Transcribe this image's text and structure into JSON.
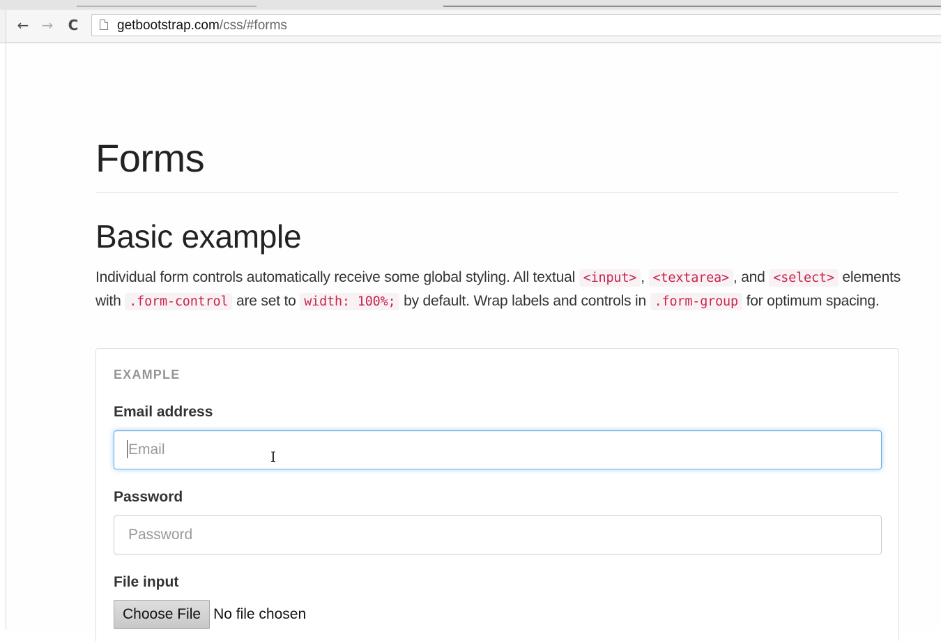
{
  "browser": {
    "back_glyph": "←",
    "forward_glyph": "→",
    "reload_glyph": "C",
    "url_host": "getbootstrap.com",
    "url_path": "/css/#forms"
  },
  "page": {
    "title": "Forms",
    "section_title": "Basic example",
    "intro": {
      "t1": "Individual form controls automatically receive some global styling. All textual ",
      "c1": "<input>",
      "t2": ", ",
      "c2": "<textarea>",
      "t3": ", and ",
      "c3": "<select>",
      "t4": " elements with ",
      "c4": ".form-control",
      "t5": " are set to ",
      "c5": "width: 100%;",
      "t6": " by default. Wrap labels and controls in ",
      "c6": ".form-group",
      "t7": " for optimum spacing."
    }
  },
  "example": {
    "label": "EXAMPLE",
    "email": {
      "label": "Email address",
      "placeholder": "Email",
      "value": ""
    },
    "password": {
      "label": "Password",
      "placeholder": "Password",
      "value": ""
    },
    "file": {
      "label": "File input",
      "button_label": "Choose File",
      "status": "No file chosen"
    }
  },
  "colors": {
    "code_text": "#c7254e",
    "code_background": "#f9f2f4",
    "focus_border": "#66afe9"
  }
}
